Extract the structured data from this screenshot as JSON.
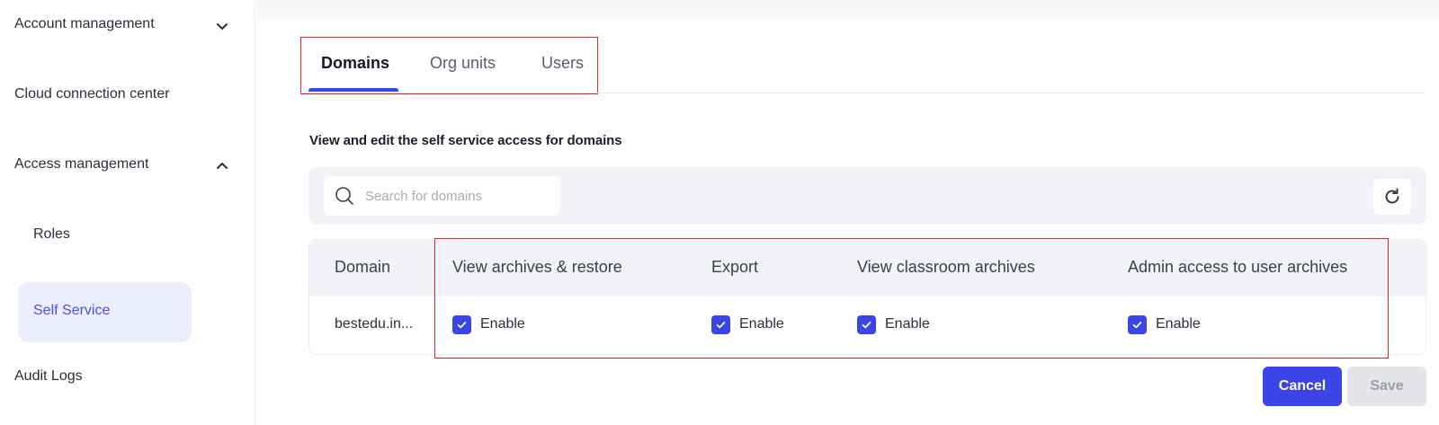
{
  "sidebar": {
    "items": [
      {
        "label": "Account management",
        "chevron": "chevron-down-icon"
      },
      {
        "label": "Cloud connection center"
      },
      {
        "label": "Access management",
        "chevron": "chevron-up-icon"
      },
      {
        "label": "Roles"
      },
      {
        "label": "Self Service",
        "active": true
      },
      {
        "label": "Audit Logs"
      }
    ]
  },
  "tabs": [
    {
      "label": "Domains",
      "active": true
    },
    {
      "label": "Org units"
    },
    {
      "label": "Users"
    }
  ],
  "section": {
    "title": "View and edit the self service access for domains"
  },
  "search": {
    "placeholder": "Search for domains",
    "value": ""
  },
  "table": {
    "headers": [
      "Domain",
      "View archives & restore",
      "Export",
      "View classroom archives",
      "Admin access to user archives"
    ],
    "rows": [
      {
        "domain": "bestedu.in...",
        "permissions": [
          {
            "label": "Enable",
            "checked": true
          },
          {
            "label": "Enable",
            "checked": true
          },
          {
            "label": "Enable",
            "checked": true
          },
          {
            "label": "Enable",
            "checked": true
          }
        ]
      }
    ]
  },
  "buttons": {
    "cancel": "Cancel",
    "save": "Save"
  },
  "colors": {
    "accent": "#3b44e6",
    "highlight": "#e1252b",
    "active_nav_bg": "#ecedfd"
  }
}
